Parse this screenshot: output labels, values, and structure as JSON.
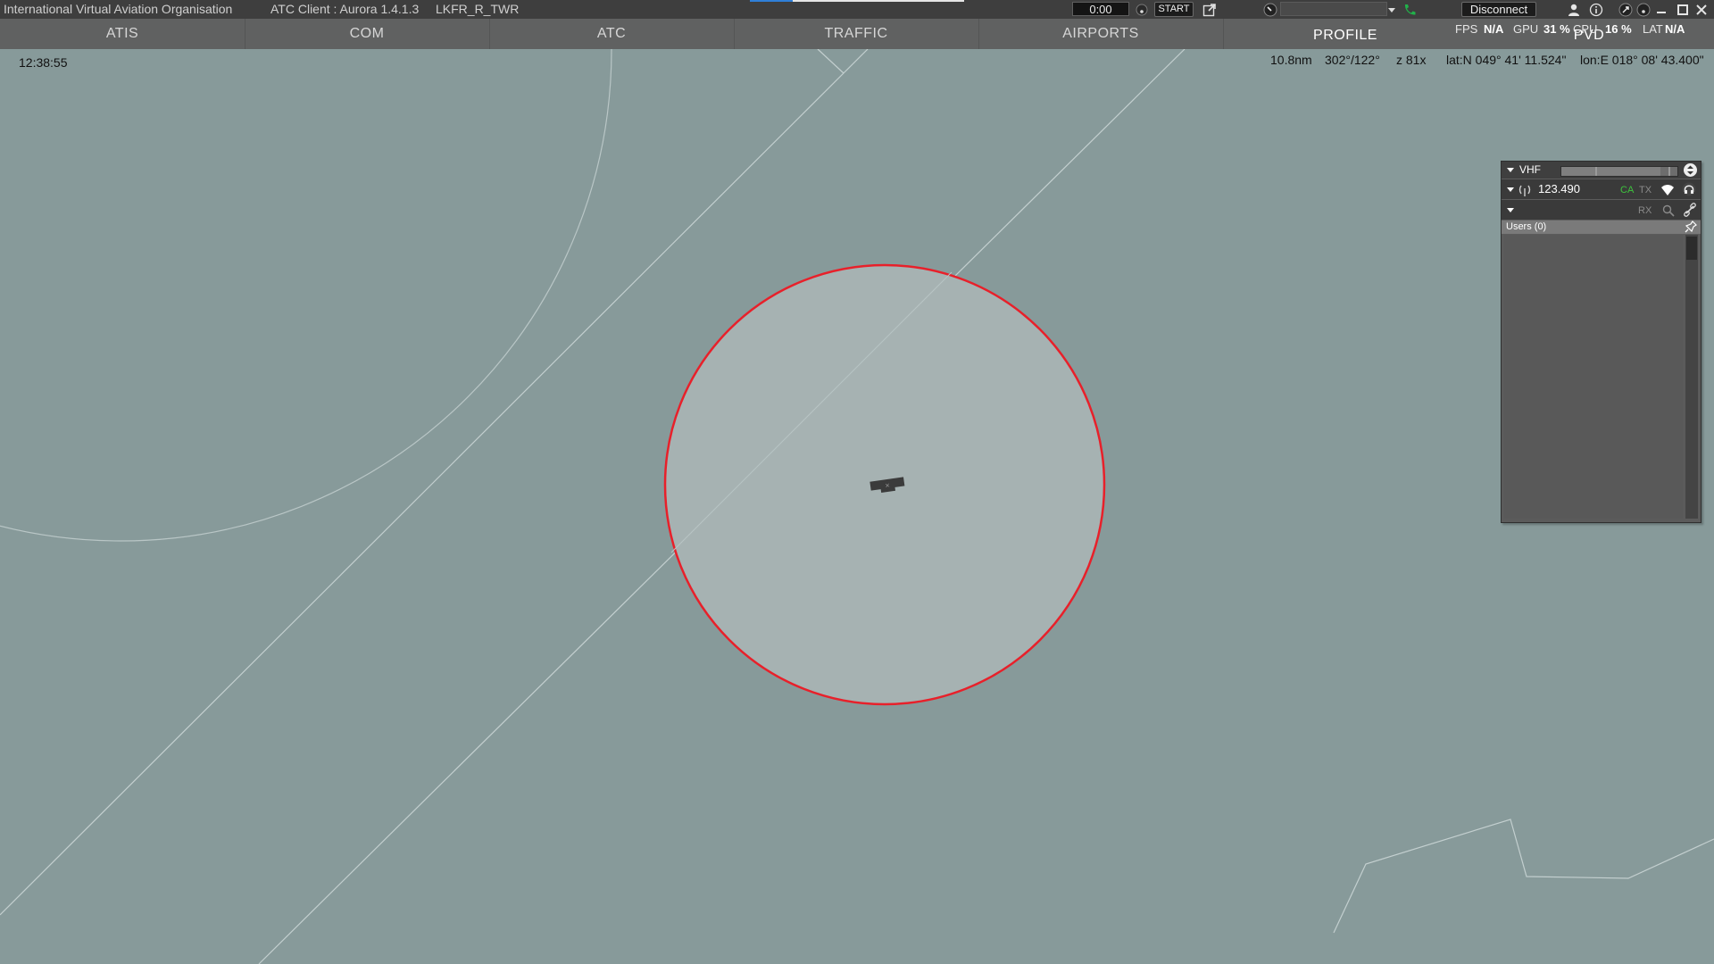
{
  "titlebar": {
    "org": "International Virtual Aviation Organisation",
    "client": "ATC Client : Aurora 1.4.1.3",
    "position": "LKFR_R_TWR",
    "timer": "0:00",
    "start_label": "START",
    "disconnect_label": "Disconnect",
    "dropdown_value": "",
    "stats": {
      "fps_label": "FPS",
      "fps_value": "N/A",
      "gpu_label": "GPU",
      "gpu_value": "31 %",
      "cpu_label": "CPU",
      "cpu_value": "16 %",
      "lat_label": "LAT",
      "lat_value": "N/A"
    }
  },
  "menu": {
    "items": [
      "ATIS",
      "COM",
      "ATC",
      "TRAFFIC",
      "AIRPORTS",
      "PROFILE",
      "PVD"
    ]
  },
  "status": {
    "clock": "12:38:55",
    "range": "10.8nm",
    "bearing": "302°/122°",
    "zoom": "z 81x",
    "lat": "lat:N 049° 41' 11.524\"",
    "lon": "lon:E 018° 08' 43.400\""
  },
  "vhf": {
    "title": "VHF",
    "frequency": "123.490",
    "ca_label": "CA",
    "tx_label": "TX",
    "rx_label": "RX",
    "users_label": "Users (0)",
    "volume_level": 0.85
  },
  "colors": {
    "map_bg": "#879a9a",
    "range_ring": "#e8202a",
    "range_fill": "#a6b2b2",
    "accent_green": "#3dc33d"
  },
  "icons": {
    "popout": "popout-icon",
    "phone": "phone-icon",
    "user": "user-icon",
    "info": "info-icon",
    "minimize": "minimize-icon",
    "maximize": "maximize-icon",
    "close": "close-icon",
    "antenna": "antenna-icon",
    "headphones": "headphones-icon",
    "wifi": "wifi-icon",
    "pin": "pin-icon",
    "aircraft": "aircraft-icon"
  }
}
